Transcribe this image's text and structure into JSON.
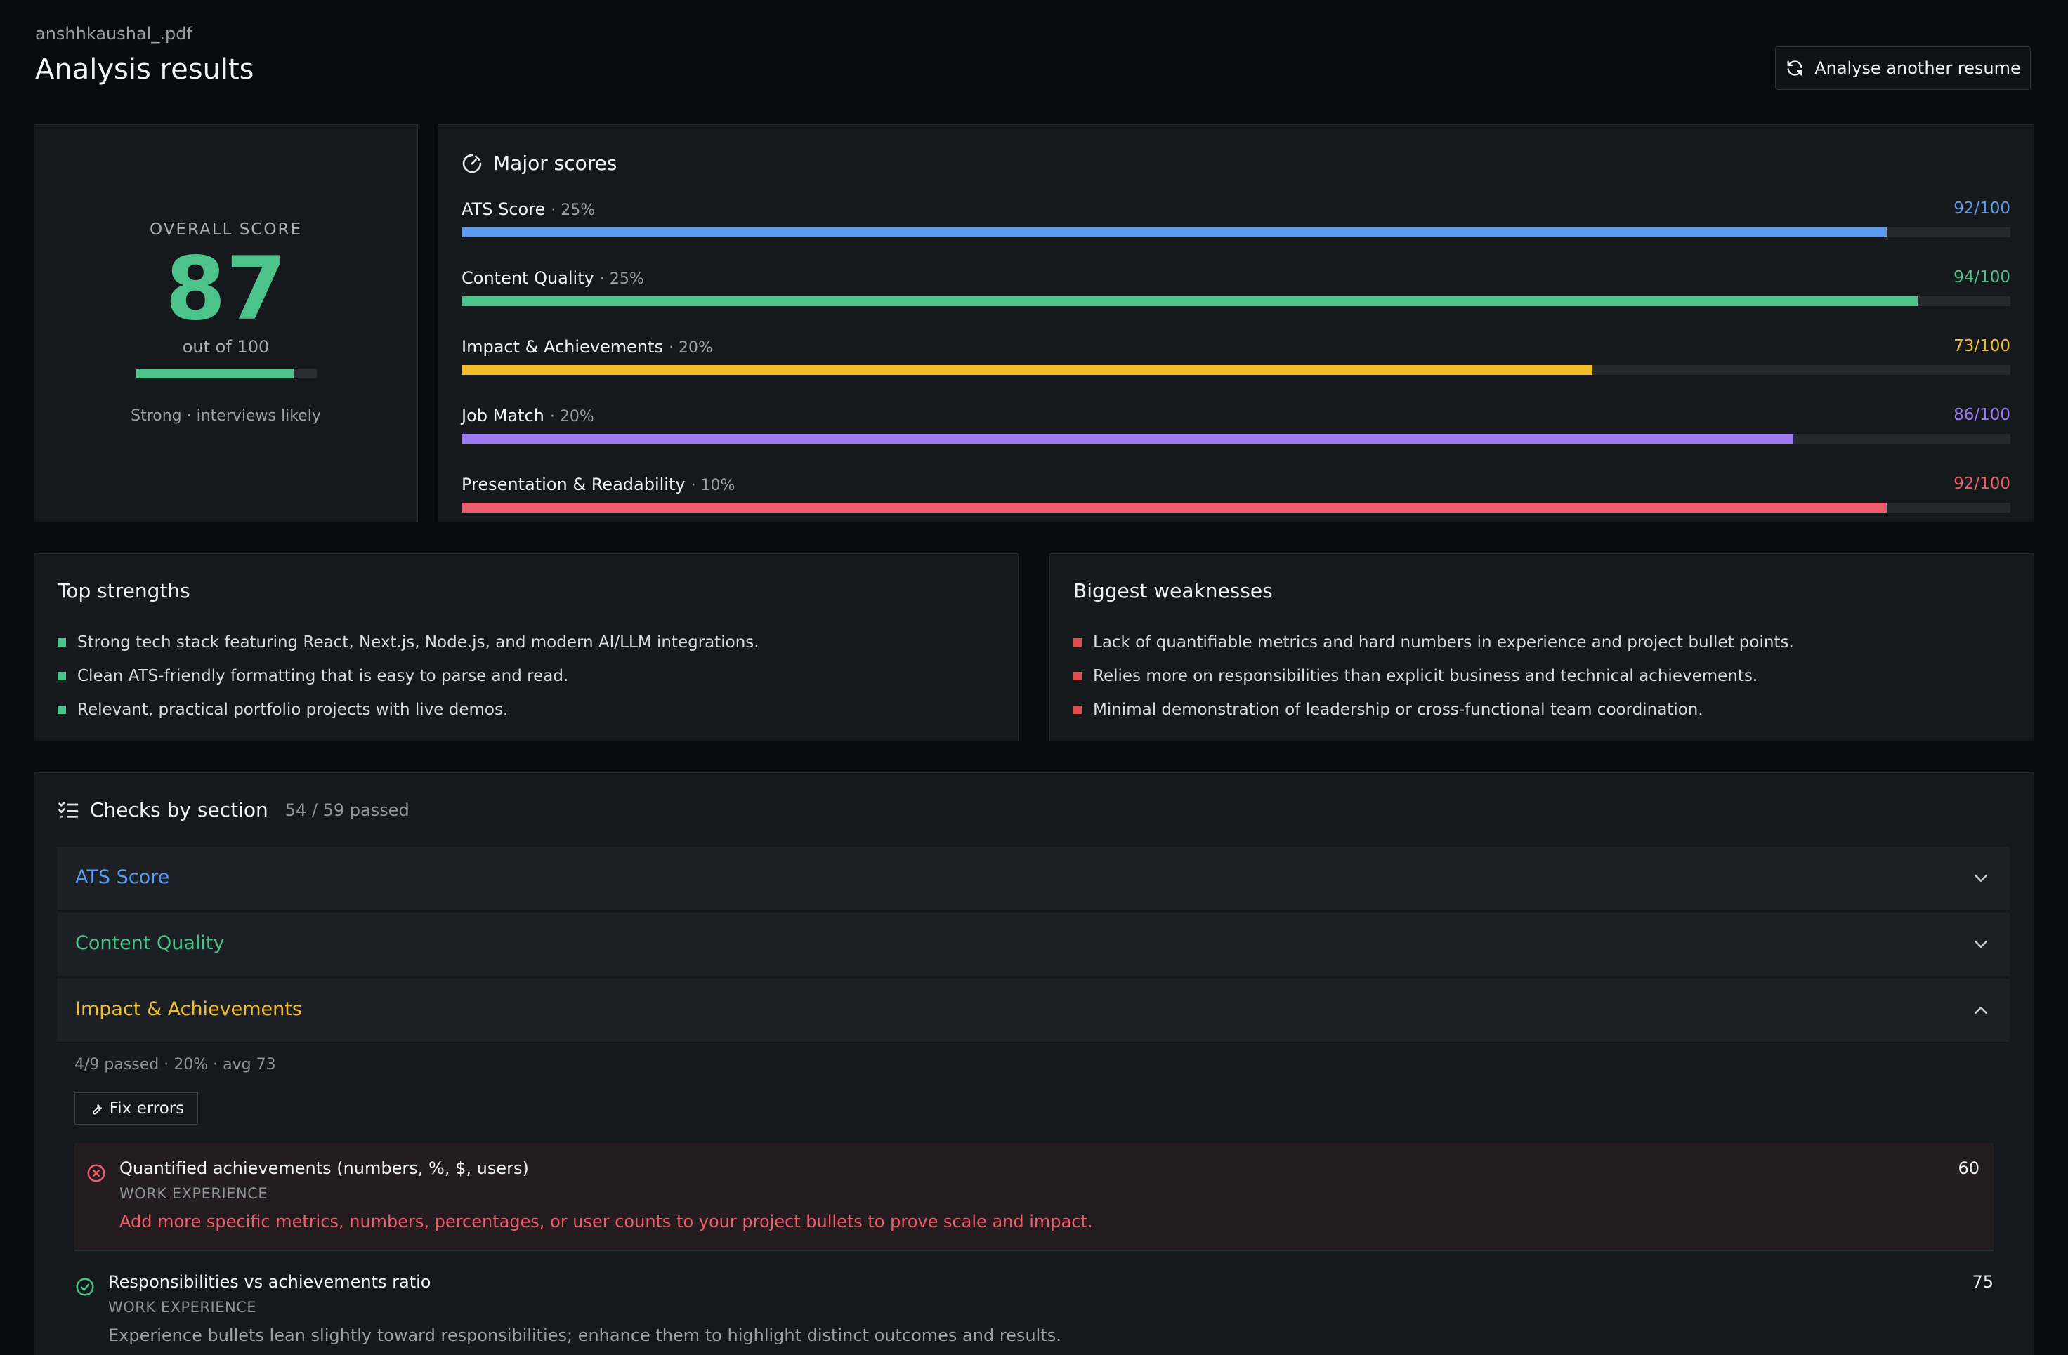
{
  "header": {
    "filename": "anshhkaushal_.pdf",
    "title": "Analysis results",
    "analyse_button_label": "Analyse another resume"
  },
  "overall": {
    "label": "OVERALL SCORE",
    "score": "87",
    "out_of": "out of 100",
    "fraction": 0.87,
    "verdict": "Strong · interviews likely",
    "color": "#4cc38a"
  },
  "major_scores": {
    "title": "Major scores",
    "items": [
      {
        "name": "ATS Score",
        "weight": "· 25%",
        "value_label": "92/100",
        "value": 92,
        "color": "#5b9cf0"
      },
      {
        "name": "Content Quality",
        "weight": "· 25%",
        "value_label": "94/100",
        "value": 94,
        "color": "#4cc38a"
      },
      {
        "name": "Impact & Achievements",
        "weight": "· 20%",
        "value_label": "73/100",
        "value": 73,
        "color": "#f2bd2b"
      },
      {
        "name": "Job Match",
        "weight": "· 20%",
        "value_label": "86/100",
        "value": 86,
        "color": "#9c7af2"
      },
      {
        "name": "Presentation & Readability",
        "weight": "· 10%",
        "value_label": "92/100",
        "value": 92,
        "color": "#ee5d6c"
      }
    ]
  },
  "strengths": {
    "title": "Top strengths",
    "color": "#4cc38a",
    "items": [
      "Strong tech stack featuring React, Next.js, Node.js, and modern AI/LLM integrations.",
      "Clean ATS-friendly formatting that is easy to parse and read.",
      "Relevant, practical portfolio projects with live demos."
    ]
  },
  "weaknesses": {
    "title": "Biggest weaknesses",
    "color": "#e5484d",
    "items": [
      "Lack of quantifiable metrics and hard numbers in experience and project bullet points.",
      "Relies more on responsibilities than explicit business and technical achievements.",
      "Minimal demonstration of leadership or cross-functional team coordination."
    ]
  },
  "checks": {
    "title": "Checks by section",
    "count": "54 / 59 passed",
    "sections": [
      {
        "label": "ATS Score",
        "color": "#5b9cf0",
        "expanded": false
      },
      {
        "label": "Content Quality",
        "color": "#4cc38a",
        "expanded": false
      },
      {
        "label": "Impact & Achievements",
        "color": "#f2bd2b",
        "expanded": true
      }
    ],
    "impact": {
      "meta_passed": "4/9 passed",
      "meta_weight": "· 20%",
      "meta_avg": "· avg 73",
      "fix_label": "Fix errors",
      "items": [
        {
          "status": "fail",
          "title": "Quantified achievements (numbers, %, $, users)",
          "section": "WORK EXPERIENCE",
          "message": "Add more specific metrics, numbers, percentages, or user counts to your project bullets to prove scale and impact.",
          "score": "60",
          "message_color": "#ee5d6c"
        },
        {
          "status": "pass",
          "title": "Responsibilities vs achievements ratio",
          "section": "WORK EXPERIENCE",
          "message": "Experience bullets lean slightly toward responsibilities; enhance them to highlight distinct outcomes and results.",
          "score": "75",
          "message_color": "#9aa0a6"
        }
      ]
    }
  }
}
